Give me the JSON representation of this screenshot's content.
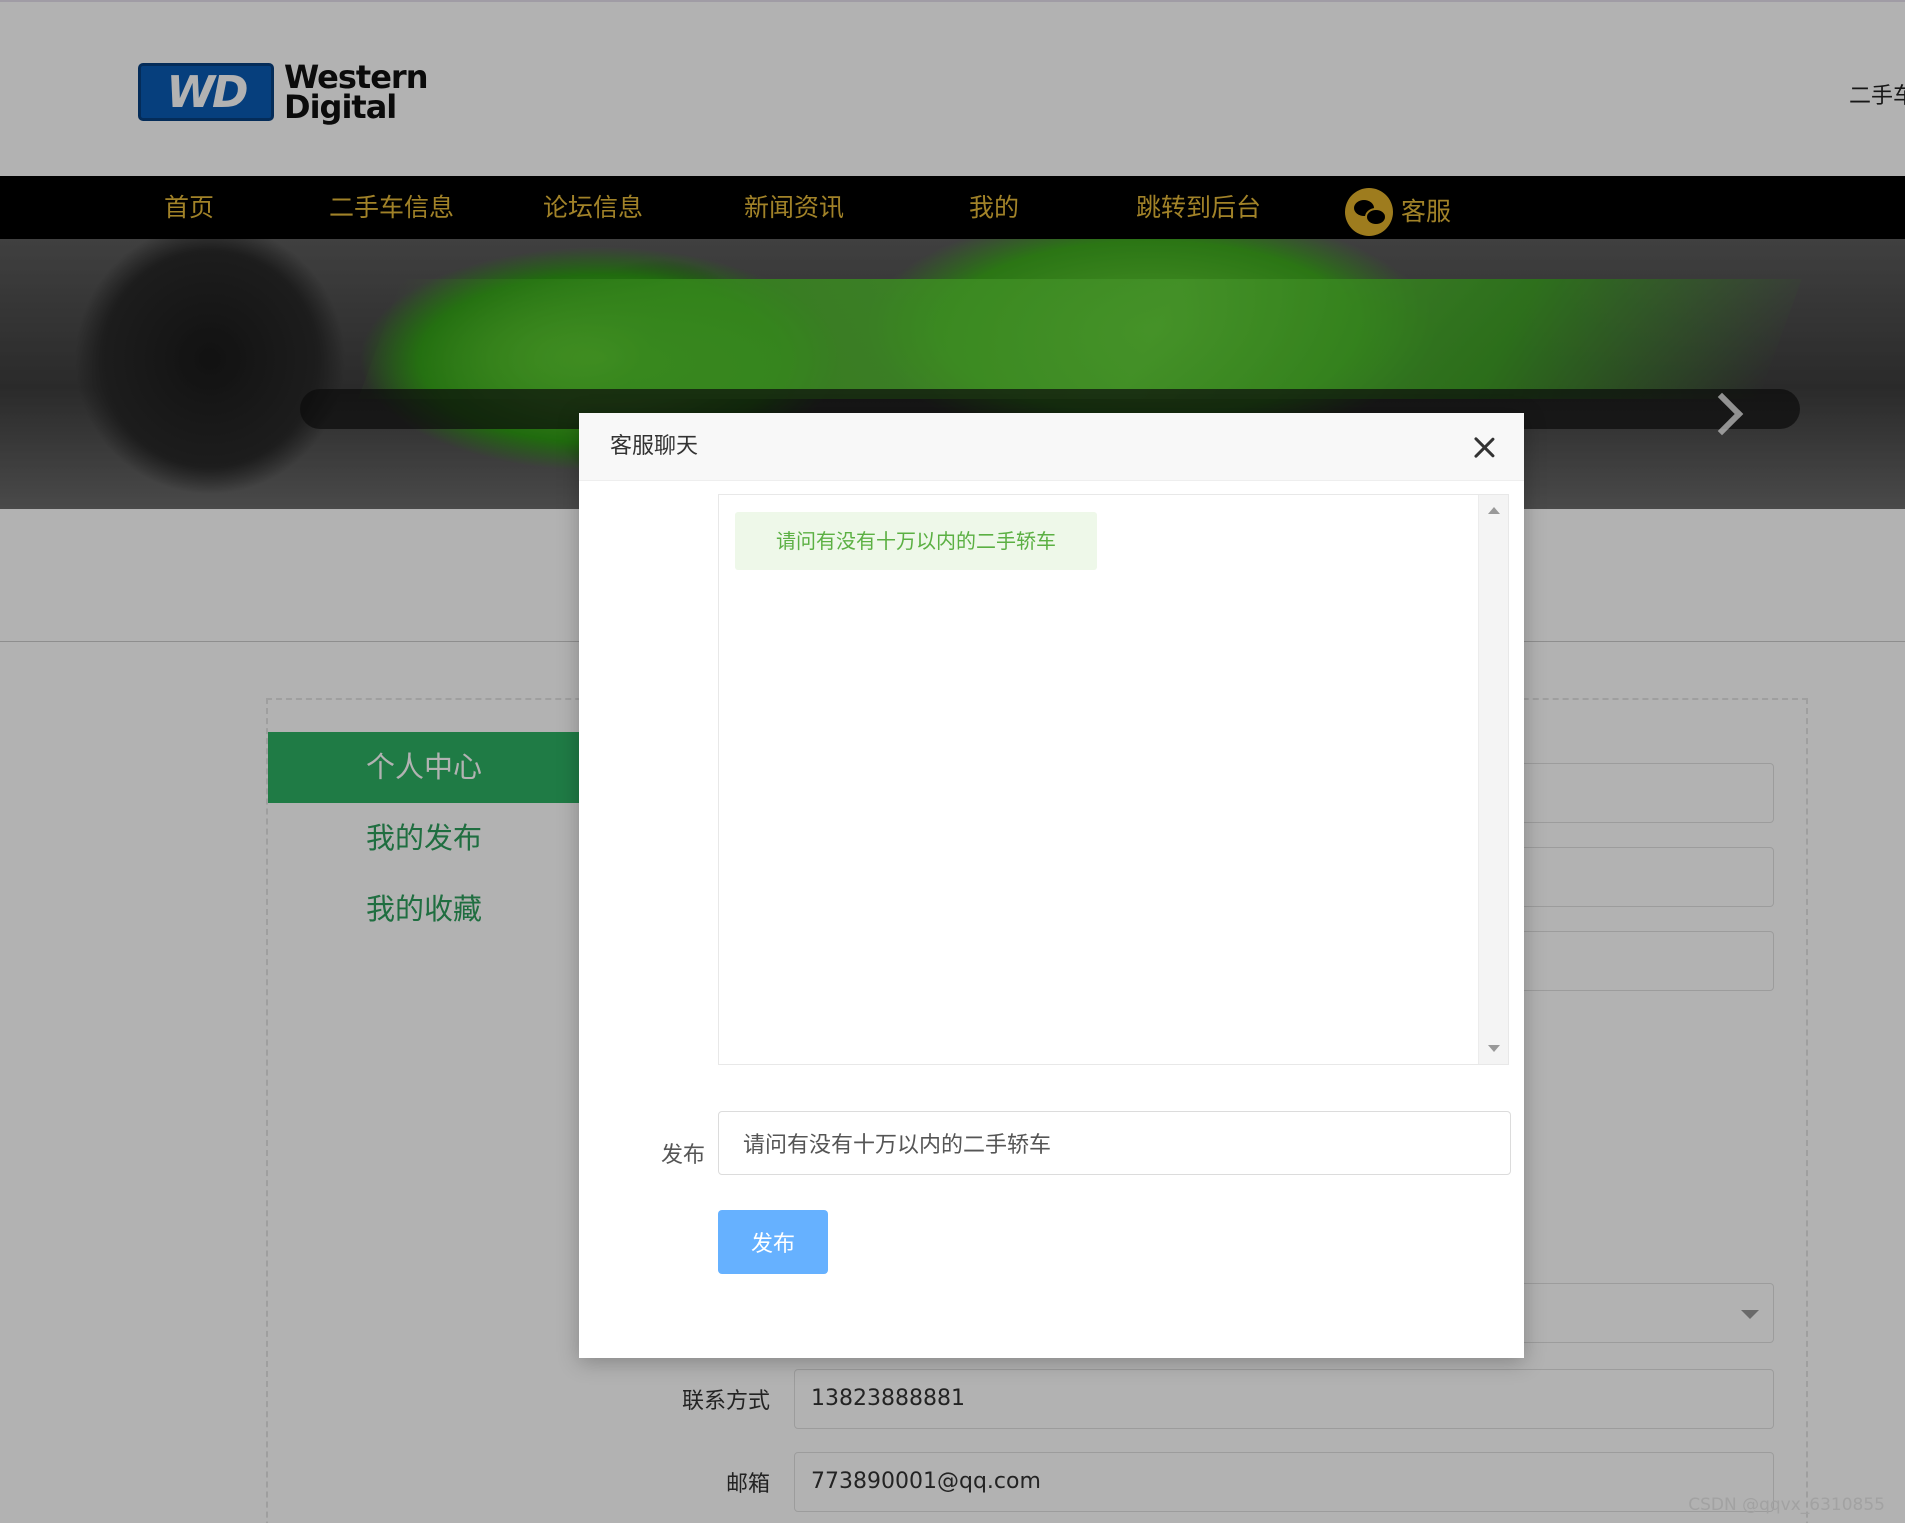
{
  "header": {
    "logo_mark": "WD",
    "logo_line1": "Western",
    "logo_line2": "Digital",
    "right_text": "二手车"
  },
  "nav": {
    "items": [
      {
        "label": "首页"
      },
      {
        "label": "二手车信息"
      },
      {
        "label": "论坛信息"
      },
      {
        "label": "新闻资讯"
      },
      {
        "label": "我的"
      },
      {
        "label": "跳转到后台"
      }
    ],
    "service": {
      "label": "客服",
      "icon": "wechat-icon"
    }
  },
  "sidebar": {
    "items": [
      {
        "label": "个人中心",
        "active": true
      },
      {
        "label": "我的发布",
        "active": false
      },
      {
        "label": "我的收藏",
        "active": false
      }
    ]
  },
  "form": {
    "contact_label": "联系方式",
    "contact_value": "13823888881",
    "email_label": "邮箱",
    "email_value": "773890001@qq.com"
  },
  "dialog": {
    "title": "客服聊天",
    "messages": [
      {
        "text": "请问有没有十万以内的二手轿车"
      }
    ],
    "publish_label": "发布",
    "input_value": "请问有没有十万以内的二手轿车",
    "button_label": "发布"
  },
  "watermark": "CSDN @qqvx_6310855",
  "colors": {
    "nav_bg": "#000000",
    "nav_text": "#e7bb3a",
    "sidebar_active": "#2db163",
    "primary_button": "#66b1ff",
    "chat_bubble_bg": "#eef8e9",
    "chat_bubble_text": "#5bb043"
  }
}
